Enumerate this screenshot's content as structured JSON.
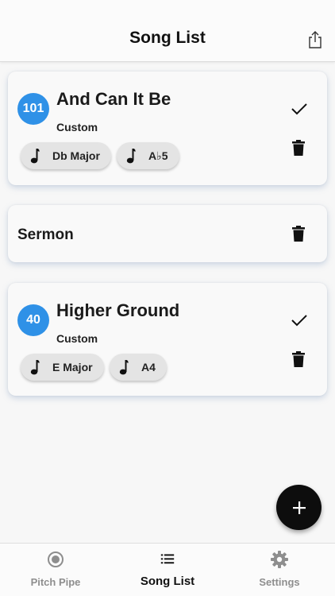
{
  "header": {
    "title": "Song List",
    "share_icon": "share-icon"
  },
  "songs": [
    {
      "number": "101",
      "title": "And Can It Be",
      "subtitle": "Custom",
      "chips": [
        "Db Major",
        "A♭5"
      ],
      "checked": true
    },
    {
      "title": "Sermon"
    },
    {
      "number": "40",
      "title": "Higher Ground",
      "subtitle": "Custom",
      "chips": [
        "E Major",
        "A4"
      ],
      "checked": true
    }
  ],
  "fab": {
    "icon": "plus-icon"
  },
  "tabs": [
    {
      "label": "Pitch Pipe",
      "icon": "radio-button-icon",
      "active": false
    },
    {
      "label": "Song List",
      "icon": "list-icon",
      "active": true
    },
    {
      "label": "Settings",
      "icon": "gear-icon",
      "active": false
    }
  ],
  "colors": {
    "accent": "#2f91e7",
    "fab": "#0d0d0d",
    "inactive_tab": "#8e8e8e"
  }
}
